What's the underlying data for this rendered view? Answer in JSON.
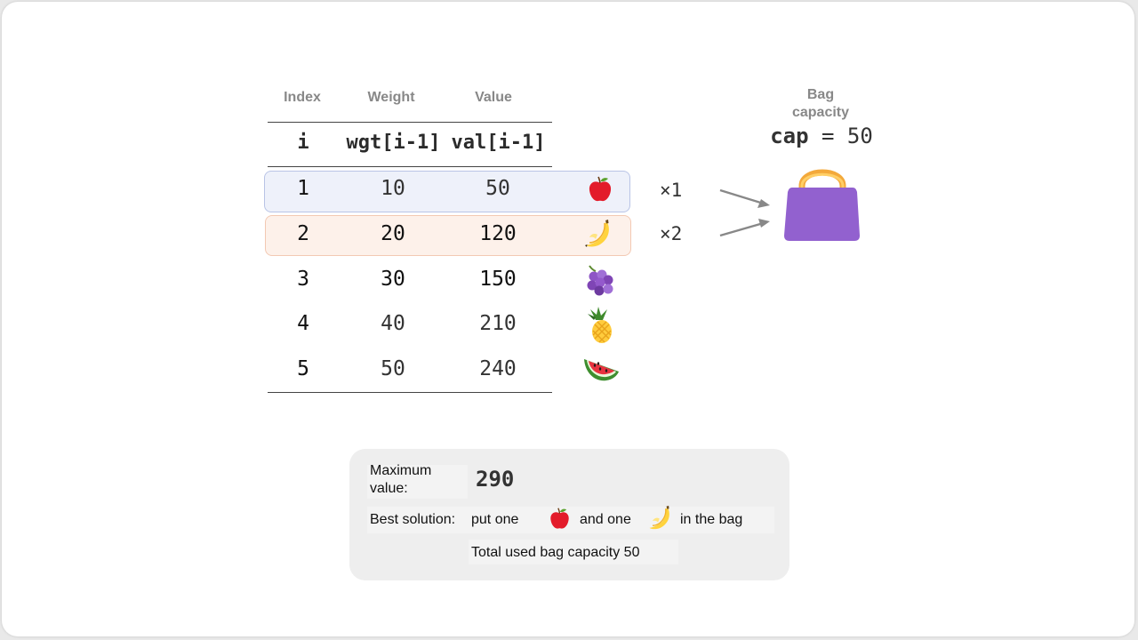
{
  "table": {
    "headers": [
      "Index",
      "Weight",
      "Value"
    ],
    "code_headers": [
      "i",
      "wgt[i-1]",
      "val[i-1]"
    ],
    "rows": [
      {
        "i": "1",
        "wgt": "10",
        "val": "50",
        "item": "apple"
      },
      {
        "i": "2",
        "wgt": "20",
        "val": "120",
        "item": "banana"
      },
      {
        "i": "3",
        "wgt": "30",
        "val": "150",
        "item": "grapes"
      },
      {
        "i": "4",
        "wgt": "40",
        "val": "210",
        "item": "pineapple"
      },
      {
        "i": "5",
        "wgt": "50",
        "val": "240",
        "item": "watermelon"
      }
    ]
  },
  "selection": {
    "row1_count": "×1",
    "row2_count": "×2",
    "row1_color": "#eef1fa",
    "row2_color": "#fdf1ea"
  },
  "bag": {
    "title_line1": "Bag",
    "title_line2": "capacity",
    "cap_var": "cap",
    "cap_eq": " = 50",
    "color": "#9261cf",
    "handle_color": "#ffc447"
  },
  "result": {
    "max_label": "Maximum value:",
    "max_value": "290",
    "best_label": "Best solution:",
    "put_one": "put one",
    "and_one": "and one",
    "in_the_bag": "in the bag",
    "total": "Total used bag capacity 50"
  }
}
